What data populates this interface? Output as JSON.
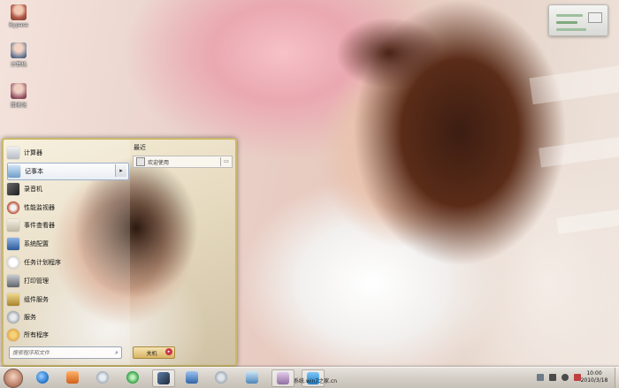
{
  "desktop": {
    "icons": [
      {
        "label": "Bypass",
        "icon": "person-icon",
        "color": "#b35a4a"
      },
      {
        "label": "计算机",
        "icon": "computer-icon",
        "color": "#6f7f9b"
      },
      {
        "label": "回收站",
        "icon": "recycle-bin-icon",
        "color": "#9b5a6a"
      }
    ]
  },
  "start_menu": {
    "items": [
      {
        "label": "计算器",
        "icon": "calculator-icon",
        "color": "#c9ccd1"
      },
      {
        "label": "记事本",
        "icon": "notepad-icon",
        "color": "#8fb6d9",
        "has_submenu": true,
        "arrow": "▸"
      },
      {
        "label": "录音机",
        "icon": "microphone-icon",
        "color": "#3a3a3a"
      },
      {
        "label": "性能监视器",
        "icon": "performance-icon",
        "color": "#b9482f"
      },
      {
        "label": "事件查看器",
        "icon": "event-viewer-icon",
        "color": "#d7d2c4"
      },
      {
        "label": "系统配置",
        "icon": "system-config-icon",
        "color": "#3f6fb1"
      },
      {
        "label": "任务计划程序",
        "icon": "task-scheduler-icon",
        "color": "#d9d9d9"
      },
      {
        "label": "打印管理",
        "icon": "printer-icon",
        "color": "#8a8f96"
      },
      {
        "label": "组件服务",
        "icon": "component-services-icon",
        "color": "#c9a64a"
      },
      {
        "label": "服务",
        "icon": "services-icon",
        "color": "#8f98a3"
      },
      {
        "label": "所有程序",
        "icon": "all-programs-icon",
        "color": "#e0a23b"
      }
    ],
    "recent": {
      "title": "最近",
      "items": [
        {
          "label": "欢迎使用",
          "pin": "▭"
        }
      ]
    },
    "search": {
      "placeholder": "搜索程序和文件",
      "icon": "⌕"
    },
    "shutdown": {
      "label": "关机",
      "arrow": "▸"
    }
  },
  "taskbar": {
    "buttons": [
      {
        "name": "ie",
        "icon": "internet-explorer-icon",
        "color": "#2f7fd1"
      },
      {
        "name": "media-player",
        "icon": "media-player-icon",
        "color": "#e0782a"
      },
      {
        "name": "network",
        "icon": "network-icon",
        "color": "#6b7f94"
      },
      {
        "name": "refresh",
        "icon": "refresh-icon",
        "color": "#2fa043"
      },
      {
        "name": "monitor",
        "icon": "performance-icon",
        "color": "#2c3b52"
      },
      {
        "name": "computer",
        "icon": "computer-icon",
        "color": "#3f78c2"
      },
      {
        "name": "settings",
        "icon": "settings-icon",
        "color": "#7a8a9a"
      },
      {
        "name": "photo",
        "icon": "image-icon",
        "color": "#4d86b9"
      },
      {
        "name": "window-1",
        "icon": "window-icon",
        "color": "#8f6f9f"
      },
      {
        "name": "window-2",
        "icon": "window-icon",
        "color": "#2c8fd1"
      }
    ],
    "tray_icons": [
      {
        "icon": "monitor-tray-icon",
        "color": "#6d7b8a"
      },
      {
        "icon": "network-tray-icon",
        "color": "#4a4a4a"
      },
      {
        "icon": "volume-tray-icon",
        "color": "#4a4a4a"
      },
      {
        "icon": "flag-tray-icon",
        "color": "#c04040"
      }
    ],
    "clock_time": "10:00",
    "clock_date": "2010/3/18",
    "watermark": "系统.win7之家.cn"
  }
}
